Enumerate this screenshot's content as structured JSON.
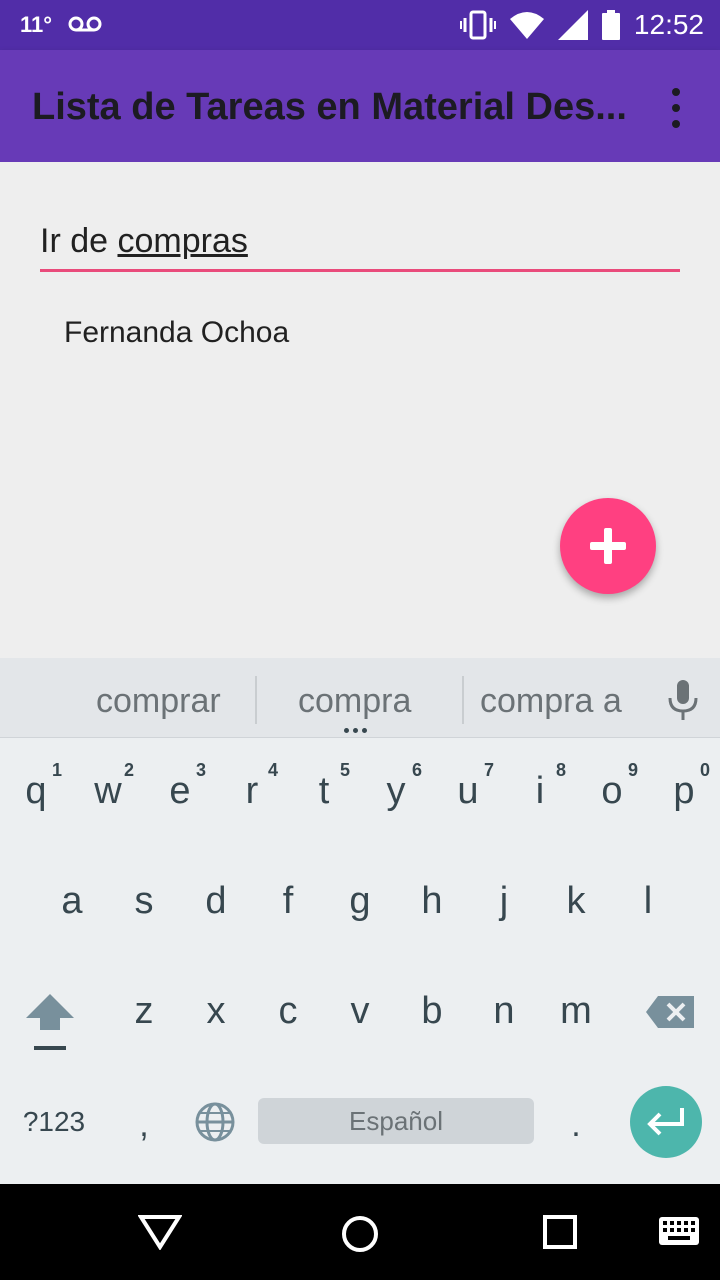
{
  "status_bar": {
    "temperature": "11°",
    "time": "12:52",
    "icons": [
      "voicemail-icon",
      "vibrate-icon",
      "wifi-icon",
      "signal-icon",
      "battery-icon"
    ]
  },
  "app_bar": {
    "title": "Lista de Tareas en Material Des...",
    "menu_icon": "more-vert-icon"
  },
  "task_input": {
    "value_prefix": "Ir de ",
    "value_composing": "compras"
  },
  "tasks": [
    {
      "label": "Fernanda Ochoa"
    }
  ],
  "fab": {
    "icon": "add-icon",
    "color": "#ff4081"
  },
  "keyboard": {
    "suggestions": [
      "comprar",
      "compra",
      "compra a"
    ],
    "row1": [
      {
        "ch": "q",
        "hint": "1"
      },
      {
        "ch": "w",
        "hint": "2"
      },
      {
        "ch": "e",
        "hint": "3"
      },
      {
        "ch": "r",
        "hint": "4"
      },
      {
        "ch": "t",
        "hint": "5"
      },
      {
        "ch": "y",
        "hint": "6"
      },
      {
        "ch": "u",
        "hint": "7"
      },
      {
        "ch": "i",
        "hint": "8"
      },
      {
        "ch": "o",
        "hint": "9"
      },
      {
        "ch": "p",
        "hint": "0"
      }
    ],
    "row2": [
      "a",
      "s",
      "d",
      "f",
      "g",
      "h",
      "j",
      "k",
      "l"
    ],
    "row3": [
      "z",
      "x",
      "c",
      "v",
      "b",
      "n",
      "m"
    ],
    "symbols_label": "?123",
    "comma": ",",
    "space_label": "Español",
    "period": ".",
    "enter_color": "#4db6ac"
  },
  "colors": {
    "status_bar": "#512da8",
    "app_bar": "#673ab7",
    "accent": "#e94b7b"
  }
}
